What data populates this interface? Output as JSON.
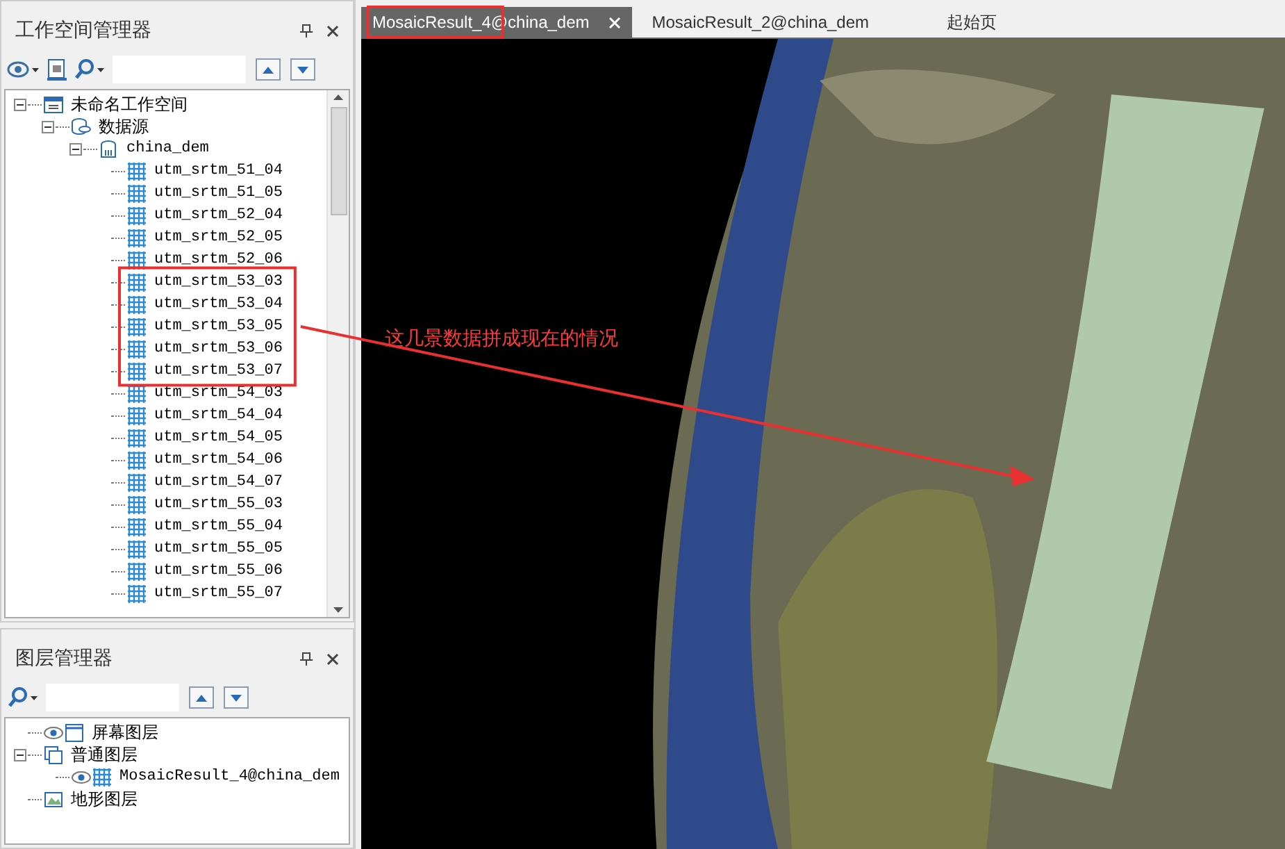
{
  "workspace_panel": {
    "title": "工作空间管理器",
    "tree": [
      {
        "label": "未命名工作空间",
        "kind": "workspace",
        "expanded": true,
        "children": [
          {
            "label": "数据源",
            "kind": "datasources",
            "expanded": true,
            "children": [
              {
                "label": "china_dem",
                "kind": "datasource",
                "expanded": true,
                "children": [
                  {
                    "label": "utm_srtm_51_04",
                    "kind": "grid",
                    "highlighted": false
                  },
                  {
                    "label": "utm_srtm_51_05",
                    "kind": "grid",
                    "highlighted": false
                  },
                  {
                    "label": "utm_srtm_52_04",
                    "kind": "grid",
                    "highlighted": false
                  },
                  {
                    "label": "utm_srtm_52_05",
                    "kind": "grid",
                    "highlighted": false
                  },
                  {
                    "label": "utm_srtm_52_06",
                    "kind": "grid",
                    "highlighted": false
                  },
                  {
                    "label": "utm_srtm_53_03",
                    "kind": "grid",
                    "highlighted": true
                  },
                  {
                    "label": "utm_srtm_53_04",
                    "kind": "grid",
                    "highlighted": true
                  },
                  {
                    "label": "utm_srtm_53_05",
                    "kind": "grid",
                    "highlighted": true
                  },
                  {
                    "label": "utm_srtm_53_06",
                    "kind": "grid",
                    "highlighted": true
                  },
                  {
                    "label": "utm_srtm_53_07",
                    "kind": "grid",
                    "highlighted": true
                  },
                  {
                    "label": "utm_srtm_54_03",
                    "kind": "grid",
                    "highlighted": false
                  },
                  {
                    "label": "utm_srtm_54_04",
                    "kind": "grid",
                    "highlighted": false
                  },
                  {
                    "label": "utm_srtm_54_05",
                    "kind": "grid",
                    "highlighted": false
                  },
                  {
                    "label": "utm_srtm_54_06",
                    "kind": "grid",
                    "highlighted": false
                  },
                  {
                    "label": "utm_srtm_54_07",
                    "kind": "grid",
                    "highlighted": false
                  },
                  {
                    "label": "utm_srtm_55_03",
                    "kind": "grid",
                    "highlighted": false
                  },
                  {
                    "label": "utm_srtm_55_04",
                    "kind": "grid",
                    "highlighted": false
                  },
                  {
                    "label": "utm_srtm_55_05",
                    "kind": "grid",
                    "highlighted": false
                  },
                  {
                    "label": "utm_srtm_55_06",
                    "kind": "grid",
                    "highlighted": false
                  },
                  {
                    "label": "utm_srtm_55_07",
                    "kind": "grid",
                    "highlighted": false
                  }
                ]
              }
            ]
          }
        ]
      }
    ]
  },
  "layer_panel": {
    "title": "图层管理器",
    "tree": [
      {
        "label": "屏幕图层",
        "kind": "screen",
        "visible": true
      },
      {
        "label": "普通图层",
        "kind": "group",
        "visible": false,
        "expanded": true,
        "children": [
          {
            "label": "MosaicResult_4@china_dem",
            "kind": "grid",
            "visible": true
          }
        ]
      },
      {
        "label": "地形图层",
        "kind": "terrain",
        "visible": false
      }
    ]
  },
  "tabs": [
    {
      "label": "MosaicResult_4@china_dem",
      "selected": true,
      "highlighted": true
    },
    {
      "label": "MosaicResult_2@china_dem",
      "selected": false,
      "highlighted": false
    },
    {
      "label": "起始页",
      "selected": false,
      "highlighted": false
    }
  ],
  "annotation": {
    "text": "这几景数据拼成现在的情况"
  }
}
